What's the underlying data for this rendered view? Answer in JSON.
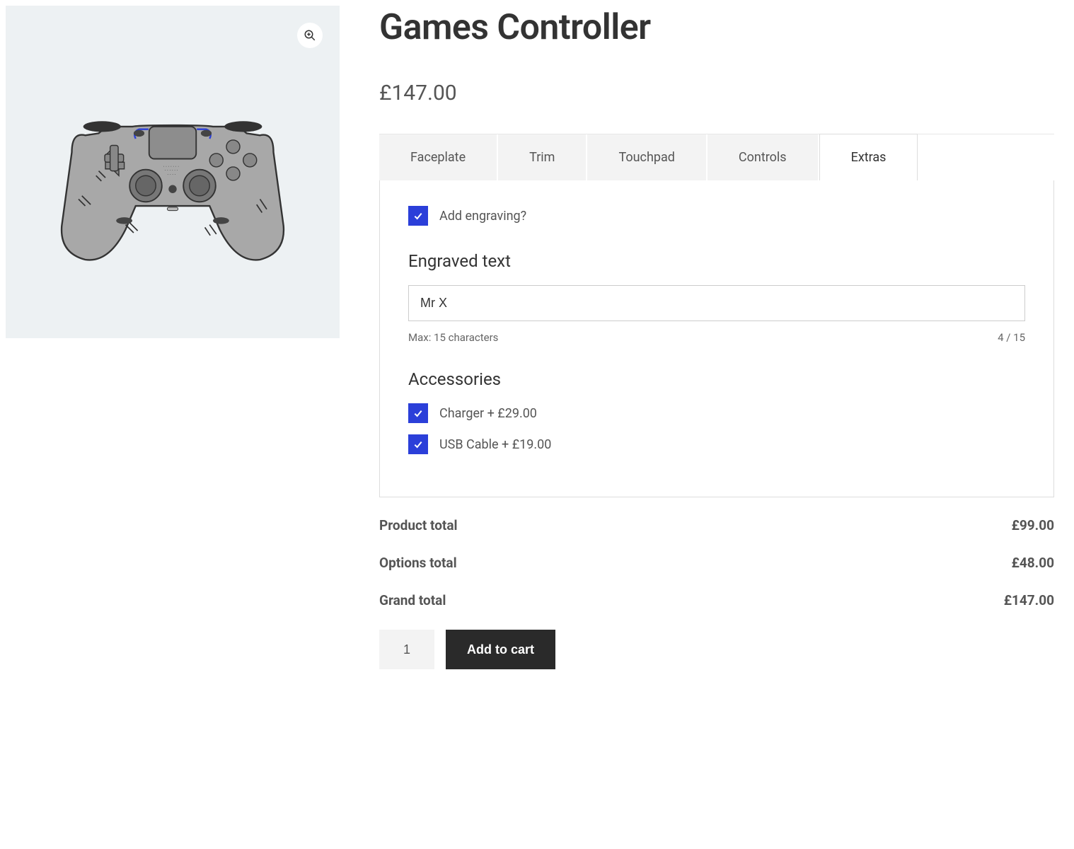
{
  "product": {
    "title": "Games Controller",
    "price_display": "£147.00"
  },
  "tabs": {
    "items": [
      {
        "label": "Faceplate"
      },
      {
        "label": "Trim"
      },
      {
        "label": "Touchpad"
      },
      {
        "label": "Controls"
      },
      {
        "label": "Extras"
      }
    ],
    "active_index": 4
  },
  "extras": {
    "engraving_checkbox_label": "Add engraving?",
    "engraving_checked": true,
    "engraved_text_heading": "Engraved text",
    "engraved_text_value": "Mr X",
    "max_hint": "Max: 15 characters",
    "char_count": "4 / 15",
    "accessories_heading": "Accessories",
    "accessories": [
      {
        "label": "Charger + £29.00",
        "checked": true
      },
      {
        "label": "USB Cable + £19.00",
        "checked": true
      }
    ]
  },
  "totals": {
    "product_label": "Product total",
    "product_value": "£99.00",
    "options_label": "Options total",
    "options_value": "£48.00",
    "grand_label": "Grand total",
    "grand_value": "£147.00"
  },
  "cart": {
    "quantity": "1",
    "button_label": "Add to cart"
  },
  "colors": {
    "checkbox_bg": "#2b3fd9"
  }
}
